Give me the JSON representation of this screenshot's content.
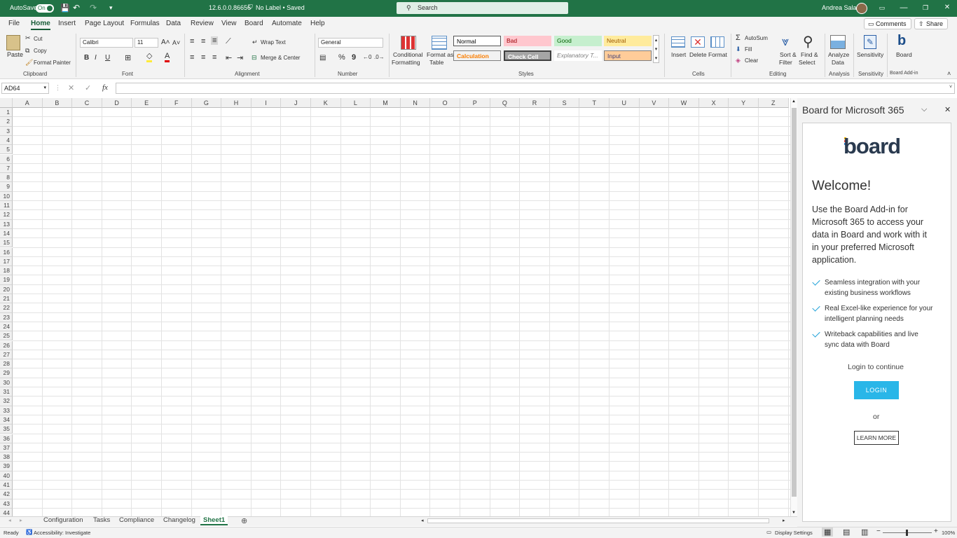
{
  "title_bar": {
    "autosave_label": "AutoSave",
    "autosave_state": "On",
    "filename": "12.6.0.0.86656",
    "sensitivity": "No Label • Saved",
    "search_placeholder": "Search",
    "user": "Andrea Sala",
    "minimize": "—",
    "restore": "❐",
    "close": "✕"
  },
  "menu": {
    "items": [
      "File",
      "Home",
      "Insert",
      "Page Layout",
      "Formulas",
      "Data",
      "Review",
      "View",
      "Board",
      "Automate",
      "Help"
    ],
    "active": "Home",
    "comments": "Comments",
    "share": "Share"
  },
  "ribbon": {
    "clipboard": {
      "paste": "Paste",
      "cut": "Cut",
      "copy": "Copy",
      "format_painter": "Format Painter",
      "group": "Clipboard"
    },
    "font": {
      "name": "Calibri",
      "size": "11",
      "bold": "B",
      "italic": "I",
      "underline": "U",
      "group": "Font"
    },
    "alignment": {
      "wrap": "Wrap Text",
      "merge": "Merge & Center",
      "group": "Alignment"
    },
    "number": {
      "format": "General",
      "percent": "%",
      "comma": "9",
      "group": "Number"
    },
    "styles": {
      "conditional_1": "Conditional",
      "conditional_2": "Formatting",
      "format_table_1": "Format as",
      "format_table_2": "Table",
      "normal": "Normal",
      "bad": "Bad",
      "good": "Good",
      "neutral": "Neutral",
      "calculation": "Calculation",
      "check_cell": "Check Cell",
      "explanatory": "Explanatory T...",
      "input": "Input",
      "group": "Styles"
    },
    "cells": {
      "insert": "Insert",
      "delete": "Delete",
      "format": "Format",
      "group": "Cells"
    },
    "editing": {
      "autosum": "AutoSum",
      "fill": "Fill",
      "clear": "Clear",
      "sort_1": "Sort &",
      "sort_2": "Filter",
      "find_1": "Find &",
      "find_2": "Select",
      "group": "Editing"
    },
    "analysis": {
      "analyze_1": "Analyze",
      "analyze_2": "Data",
      "group": "Analysis"
    },
    "sensitivity": {
      "label": "Sensitivity",
      "group": "Sensitivity"
    },
    "board_addin": {
      "label": "Board",
      "group": "Board Add-in"
    }
  },
  "formula_bar": {
    "name_box": "AD64",
    "fx": "fx",
    "value": ""
  },
  "grid": {
    "columns": [
      "A",
      "B",
      "C",
      "D",
      "E",
      "F",
      "G",
      "H",
      "I",
      "J",
      "K",
      "L",
      "M",
      "N",
      "O",
      "P",
      "Q",
      "R",
      "S",
      "T",
      "U",
      "V",
      "W",
      "X",
      "Y",
      "Z"
    ],
    "row_count": 44
  },
  "sheet_tabs": {
    "tabs": [
      "Configuration",
      "Tasks",
      "Compliance",
      "Changelog",
      "Sheet1"
    ],
    "active": "Sheet1"
  },
  "status_bar": {
    "ready": "Ready",
    "accessibility": "Accessibility: Investigate",
    "display_settings": "Display Settings",
    "zoom": "100%"
  },
  "task_pane": {
    "title": "Board for Microsoft 365",
    "logo_text": "board",
    "welcome": "Welcome!",
    "intro_lines": [
      "Use the Board Add-in for",
      "Microsoft 365 to access your",
      "data in Board and work with it",
      "in your preferred Microsoft",
      "application."
    ],
    "features": [
      {
        "line1": "Seamless integration with your",
        "line2": "existing business workflows"
      },
      {
        "line1": "Real Excel-like experience for your",
        "line2": "intelligent planning needs"
      },
      {
        "line1": "Writeback capabilities and live",
        "line2": "sync data with Board"
      }
    ],
    "login_prompt": "Login to continue",
    "login_button": "LOGIN",
    "or": "or",
    "learn_more_button": "LEARN MORE",
    "accent_color": "#29b6e8",
    "check_color": "#1ba0d8"
  }
}
